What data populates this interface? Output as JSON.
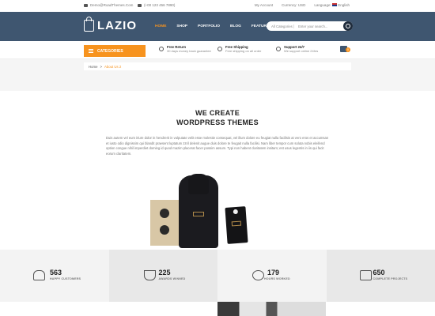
{
  "topbar": {
    "email": "Demo@RoadThemes.Com",
    "phone": "(+00 123 456 7890)",
    "account": "My Account",
    "currency_label": "Currency:",
    "currency_value": "USD",
    "language_label": "Language:",
    "language_value": "English"
  },
  "header": {
    "logo_text": "LAZIO",
    "nav": [
      "HOME",
      "SHOP",
      "PORTFOLIO",
      "BLOG",
      "FEATURES"
    ],
    "search_category": "All Categories",
    "search_placeholder": "Enter your search..."
  },
  "servicebar": {
    "categories_label": "CATEGORIES",
    "items": [
      {
        "title": "Free Return",
        "sub": "30 days money back guarantee"
      },
      {
        "title": "Free Shipping",
        "sub": "Free shipping on all order"
      },
      {
        "title": "Support 24/7",
        "sub": "We support online 24hrs"
      }
    ],
    "cart_count": "0"
  },
  "breadcrumb": {
    "home": "Home",
    "separator": ">",
    "current": "About Us 2"
  },
  "intro": {
    "heading_line1": "WE CREATE",
    "heading_line2": "WORDPRESS THEMES",
    "paragraph": "Duis autem vel eum iriure dolor in hendrerit in vulputate velit esse molestie consequat, vel illum dolore eu feugiat nulla facilisis at vero eros et accumsan et iusto odio dignissim qui blandit praesent luptatum zzril delenit augue duis dolore te feugait nulla facilisi. Nam liber tempor cum soluta nobis eleifend option congue nihil imperdiet doming id quod mazim placerat facer possim assum. Typi non habent claritatem insitam; est usus legentis in iis qui facit eorum claritatem."
  },
  "stats": [
    {
      "icon": "people-icon",
      "number": "563",
      "label": "HAPPY CUSTOMERS"
    },
    {
      "icon": "trophy-icon",
      "number": "225",
      "label": "AWARDS WINNED"
    },
    {
      "icon": "clock-icon",
      "number": "179",
      "label": "HOURS WORKED"
    },
    {
      "icon": "thumbs-up-icon",
      "number": "650",
      "label": "COMPLETE PROJECTS"
    }
  ],
  "colors": {
    "header_bg": "#3f5670",
    "accent": "#f7931e"
  }
}
